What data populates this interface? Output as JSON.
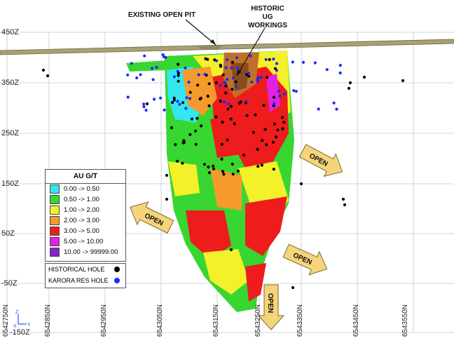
{
  "annotations": {
    "existing_pit": "EXISTING OPEN PIT",
    "historic_ug": [
      "HISTORIC",
      "UG WORKINGS"
    ]
  },
  "z_axis": [
    "450Z",
    "350Z",
    "250Z",
    "150Z",
    "50Z",
    "-50Z",
    "-150Z"
  ],
  "n_axis": [
    "6542750N",
    "6542850N",
    "6542950N",
    "6543050N",
    "6543150N",
    "6543250N",
    "6543350N",
    "6543450N",
    "6543550N"
  ],
  "legend": {
    "title": "AU G/T",
    "items": [
      {
        "label": "0.00 -> 0.50",
        "color": "#33e6f0"
      },
      {
        "label": "0.50 -> 1.00",
        "color": "#38d630"
      },
      {
        "label": "1.00 -> 2.00",
        "color": "#f3f12a"
      },
      {
        "label": "2.00 -> 3.00",
        "color": "#f59a2c"
      },
      {
        "label": "3.00 -> 5.00",
        "color": "#ee1c1c"
      },
      {
        "label": "5.00 -> 10.00",
        "color": "#e222e0"
      },
      {
        "label": "10.00 -> 99999.00",
        "color": "#8a22c8"
      }
    ]
  },
  "hole_legend": [
    {
      "label": "HISTORICAL HOLE",
      "color": "#000000"
    },
    {
      "label": "KARORA RES HOLE",
      "color": "#1a2bff"
    }
  ],
  "open_arrows": [
    "OPEN",
    "OPEN",
    "OPEN",
    "OPEN"
  ],
  "triad": {
    "z": "Z",
    "x": "X",
    "y": "Y"
  },
  "colors": {
    "arrow_fill": "#f5d57a",
    "arrow_stroke": "#7a6a35",
    "grid": "#bfc6d6",
    "surface": "#a8a173"
  }
}
